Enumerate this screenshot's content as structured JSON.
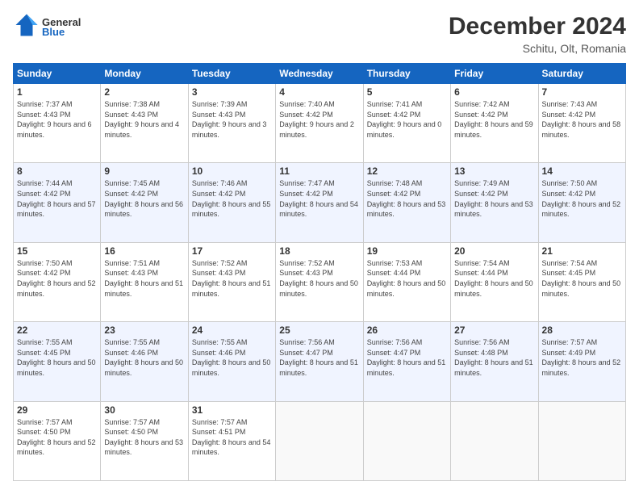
{
  "header": {
    "logo_general": "General",
    "logo_blue": "Blue",
    "month_title": "December 2024",
    "location": "Schitu, Olt, Romania"
  },
  "weekdays": [
    "Sunday",
    "Monday",
    "Tuesday",
    "Wednesday",
    "Thursday",
    "Friday",
    "Saturday"
  ],
  "weeks": [
    [
      {
        "day": "1",
        "sunrise": "Sunrise: 7:37 AM",
        "sunset": "Sunset: 4:43 PM",
        "daylight": "Daylight: 9 hours and 6 minutes."
      },
      {
        "day": "2",
        "sunrise": "Sunrise: 7:38 AM",
        "sunset": "Sunset: 4:43 PM",
        "daylight": "Daylight: 9 hours and 4 minutes."
      },
      {
        "day": "3",
        "sunrise": "Sunrise: 7:39 AM",
        "sunset": "Sunset: 4:43 PM",
        "daylight": "Daylight: 9 hours and 3 minutes."
      },
      {
        "day": "4",
        "sunrise": "Sunrise: 7:40 AM",
        "sunset": "Sunset: 4:42 PM",
        "daylight": "Daylight: 9 hours and 2 minutes."
      },
      {
        "day": "5",
        "sunrise": "Sunrise: 7:41 AM",
        "sunset": "Sunset: 4:42 PM",
        "daylight": "Daylight: 9 hours and 0 minutes."
      },
      {
        "day": "6",
        "sunrise": "Sunrise: 7:42 AM",
        "sunset": "Sunset: 4:42 PM",
        "daylight": "Daylight: 8 hours and 59 minutes."
      },
      {
        "day": "7",
        "sunrise": "Sunrise: 7:43 AM",
        "sunset": "Sunset: 4:42 PM",
        "daylight": "Daylight: 8 hours and 58 minutes."
      }
    ],
    [
      {
        "day": "8",
        "sunrise": "Sunrise: 7:44 AM",
        "sunset": "Sunset: 4:42 PM",
        "daylight": "Daylight: 8 hours and 57 minutes."
      },
      {
        "day": "9",
        "sunrise": "Sunrise: 7:45 AM",
        "sunset": "Sunset: 4:42 PM",
        "daylight": "Daylight: 8 hours and 56 minutes."
      },
      {
        "day": "10",
        "sunrise": "Sunrise: 7:46 AM",
        "sunset": "Sunset: 4:42 PM",
        "daylight": "Daylight: 8 hours and 55 minutes."
      },
      {
        "day": "11",
        "sunrise": "Sunrise: 7:47 AM",
        "sunset": "Sunset: 4:42 PM",
        "daylight": "Daylight: 8 hours and 54 minutes."
      },
      {
        "day": "12",
        "sunrise": "Sunrise: 7:48 AM",
        "sunset": "Sunset: 4:42 PM",
        "daylight": "Daylight: 8 hours and 53 minutes."
      },
      {
        "day": "13",
        "sunrise": "Sunrise: 7:49 AM",
        "sunset": "Sunset: 4:42 PM",
        "daylight": "Daylight: 8 hours and 53 minutes."
      },
      {
        "day": "14",
        "sunrise": "Sunrise: 7:50 AM",
        "sunset": "Sunset: 4:42 PM",
        "daylight": "Daylight: 8 hours and 52 minutes."
      }
    ],
    [
      {
        "day": "15",
        "sunrise": "Sunrise: 7:50 AM",
        "sunset": "Sunset: 4:42 PM",
        "daylight": "Daylight: 8 hours and 52 minutes."
      },
      {
        "day": "16",
        "sunrise": "Sunrise: 7:51 AM",
        "sunset": "Sunset: 4:43 PM",
        "daylight": "Daylight: 8 hours and 51 minutes."
      },
      {
        "day": "17",
        "sunrise": "Sunrise: 7:52 AM",
        "sunset": "Sunset: 4:43 PM",
        "daylight": "Daylight: 8 hours and 51 minutes."
      },
      {
        "day": "18",
        "sunrise": "Sunrise: 7:52 AM",
        "sunset": "Sunset: 4:43 PM",
        "daylight": "Daylight: 8 hours and 50 minutes."
      },
      {
        "day": "19",
        "sunrise": "Sunrise: 7:53 AM",
        "sunset": "Sunset: 4:44 PM",
        "daylight": "Daylight: 8 hours and 50 minutes."
      },
      {
        "day": "20",
        "sunrise": "Sunrise: 7:54 AM",
        "sunset": "Sunset: 4:44 PM",
        "daylight": "Daylight: 8 hours and 50 minutes."
      },
      {
        "day": "21",
        "sunrise": "Sunrise: 7:54 AM",
        "sunset": "Sunset: 4:45 PM",
        "daylight": "Daylight: 8 hours and 50 minutes."
      }
    ],
    [
      {
        "day": "22",
        "sunrise": "Sunrise: 7:55 AM",
        "sunset": "Sunset: 4:45 PM",
        "daylight": "Daylight: 8 hours and 50 minutes."
      },
      {
        "day": "23",
        "sunrise": "Sunrise: 7:55 AM",
        "sunset": "Sunset: 4:46 PM",
        "daylight": "Daylight: 8 hours and 50 minutes."
      },
      {
        "day": "24",
        "sunrise": "Sunrise: 7:55 AM",
        "sunset": "Sunset: 4:46 PM",
        "daylight": "Daylight: 8 hours and 50 minutes."
      },
      {
        "day": "25",
        "sunrise": "Sunrise: 7:56 AM",
        "sunset": "Sunset: 4:47 PM",
        "daylight": "Daylight: 8 hours and 51 minutes."
      },
      {
        "day": "26",
        "sunrise": "Sunrise: 7:56 AM",
        "sunset": "Sunset: 4:47 PM",
        "daylight": "Daylight: 8 hours and 51 minutes."
      },
      {
        "day": "27",
        "sunrise": "Sunrise: 7:56 AM",
        "sunset": "Sunset: 4:48 PM",
        "daylight": "Daylight: 8 hours and 51 minutes."
      },
      {
        "day": "28",
        "sunrise": "Sunrise: 7:57 AM",
        "sunset": "Sunset: 4:49 PM",
        "daylight": "Daylight: 8 hours and 52 minutes."
      }
    ],
    [
      {
        "day": "29",
        "sunrise": "Sunrise: 7:57 AM",
        "sunset": "Sunset: 4:50 PM",
        "daylight": "Daylight: 8 hours and 52 minutes."
      },
      {
        "day": "30",
        "sunrise": "Sunrise: 7:57 AM",
        "sunset": "Sunset: 4:50 PM",
        "daylight": "Daylight: 8 hours and 53 minutes."
      },
      {
        "day": "31",
        "sunrise": "Sunrise: 7:57 AM",
        "sunset": "Sunset: 4:51 PM",
        "daylight": "Daylight: 8 hours and 54 minutes."
      },
      null,
      null,
      null,
      null
    ]
  ]
}
